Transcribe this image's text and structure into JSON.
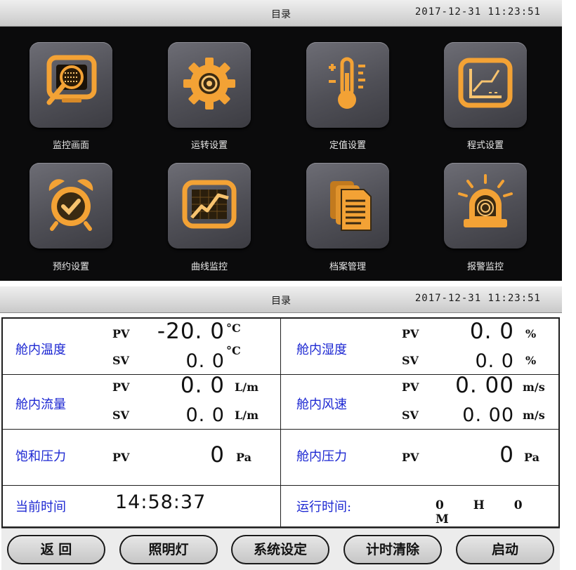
{
  "menu_screen": {
    "title": "目录",
    "datetime": "2017-12-31   11:23:51",
    "tiles": [
      {
        "label": "监控画面",
        "icon": "monitor-magnifier-icon"
      },
      {
        "label": "运转设置",
        "icon": "gear-icon"
      },
      {
        "label": "定值设置",
        "icon": "thermometer-icon"
      },
      {
        "label": "程式设置",
        "icon": "program-chart-icon"
      },
      {
        "label": "预约设置",
        "icon": "alarm-clock-icon"
      },
      {
        "label": "曲线监控",
        "icon": "curve-chart-icon"
      },
      {
        "label": "档案管理",
        "icon": "documents-icon"
      },
      {
        "label": "报警监控",
        "icon": "alarm-beacon-icon"
      }
    ],
    "accent": "#f0a030"
  },
  "monitor_screen": {
    "title": "目录",
    "datetime": "2017-12-31   11:23:51",
    "cabin_temp": {
      "label": "舱内温度",
      "pv_tag": "PV",
      "sv_tag": "SV",
      "pv": "-20. 0",
      "sv": "0. 0",
      "unit": "°C"
    },
    "cabin_humidity": {
      "label": "舱内湿度",
      "pv_tag": "PV",
      "sv_tag": "SV",
      "pv": "0. 0",
      "sv": "0. 0",
      "unit": "%"
    },
    "cabin_flow": {
      "label": "舱内流量",
      "pv_tag": "PV",
      "sv_tag": "SV",
      "pv": "0. 0",
      "sv": "0. 0",
      "unit": "L/m"
    },
    "cabin_wind": {
      "label": "舱内风速",
      "pv_tag": "PV",
      "sv_tag": "SV",
      "pv": "0. 00",
      "sv": "0. 00",
      "unit": "m/s"
    },
    "sat_pressure": {
      "label": "饱和压力",
      "pv_tag": "PV",
      "pv": "0",
      "unit": "Pa"
    },
    "cabin_pressure": {
      "label": "舱内压力",
      "pv_tag": "PV",
      "pv": "0",
      "unit": "Pa"
    },
    "current_time": {
      "label": "当前时间",
      "value": "14:58:37"
    },
    "run_time": {
      "label": "运行时间:",
      "value": "0 H 0 M"
    },
    "buttons": {
      "back": "返 回",
      "light": "照明灯",
      "system": "系统设定",
      "timer_clear": "计时清除",
      "start": "启动"
    },
    "label_color": "#1c27d2"
  }
}
